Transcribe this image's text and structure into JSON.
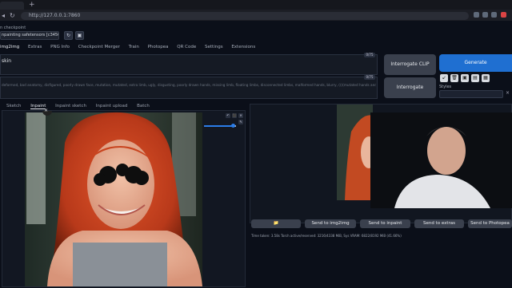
{
  "browser": {
    "new_tab": "+",
    "url": "http://127.0.0.1:7860"
  },
  "top": {
    "checkpoint_label": "n checkpoint",
    "checkpoint_value": "npainting safetensors [c3450e0]",
    "refresh_icon": "↻",
    "save_icon": "▣"
  },
  "nav": {
    "tabs": [
      "img2img",
      "Extras",
      "PNG Info",
      "Checkpoint Merger",
      "Train",
      "Photopea",
      "QR Code",
      "Settings",
      "Extensions"
    ],
    "active": "img2img"
  },
  "prompt": {
    "text": "skin",
    "tokens": "0/75"
  },
  "negative_prompt": {
    "text": "deformed, bad anatomy, disfigured, poorly drawn face, mutation, mutated, extra limb, ugly, disgusting, poorly drawn hands, missing limb, floating limbs, disconnected limbs, malformed hands, blurry, ((((mutated hands and fingers)))), watermark, watermarked, oversaturated, censored, distorted hands, amputation, missing hands, obese, doubled face, double hands",
    "tokens": "0/75"
  },
  "right": {
    "interrogate_clip": "Interrogate CLIP",
    "interrogate_deepbooru": "Interrogate DeepBooru",
    "generate": "Generate",
    "styles_label": "Styles",
    "icons": [
      "↙",
      "🗑",
      "▣",
      "▤",
      "▦"
    ],
    "clear": "×"
  },
  "subtabs": {
    "items": [
      "Sketch",
      "Inpaint",
      "Inpaint sketch",
      "Inpaint upload",
      "Batch"
    ],
    "active": "Inpaint"
  },
  "canvas": {
    "tools": [
      "↶",
      "⬛",
      "✕",
      "✎"
    ],
    "close": "×"
  },
  "brush": {
    "size": 0.9
  },
  "output": {
    "buttons": [
      "📁",
      "Send to img2img",
      "Send to inpaint",
      "Send to extras",
      "Send to Photopea"
    ],
    "timing": "Time taken: 3.58s  Torch active/reserved: 3216/4338 MiB, Sys VRAM: 6822/8192 MiB (41.66%)"
  },
  "colors": {
    "accent": "#1f6fd1",
    "background": "#0b0f19"
  }
}
